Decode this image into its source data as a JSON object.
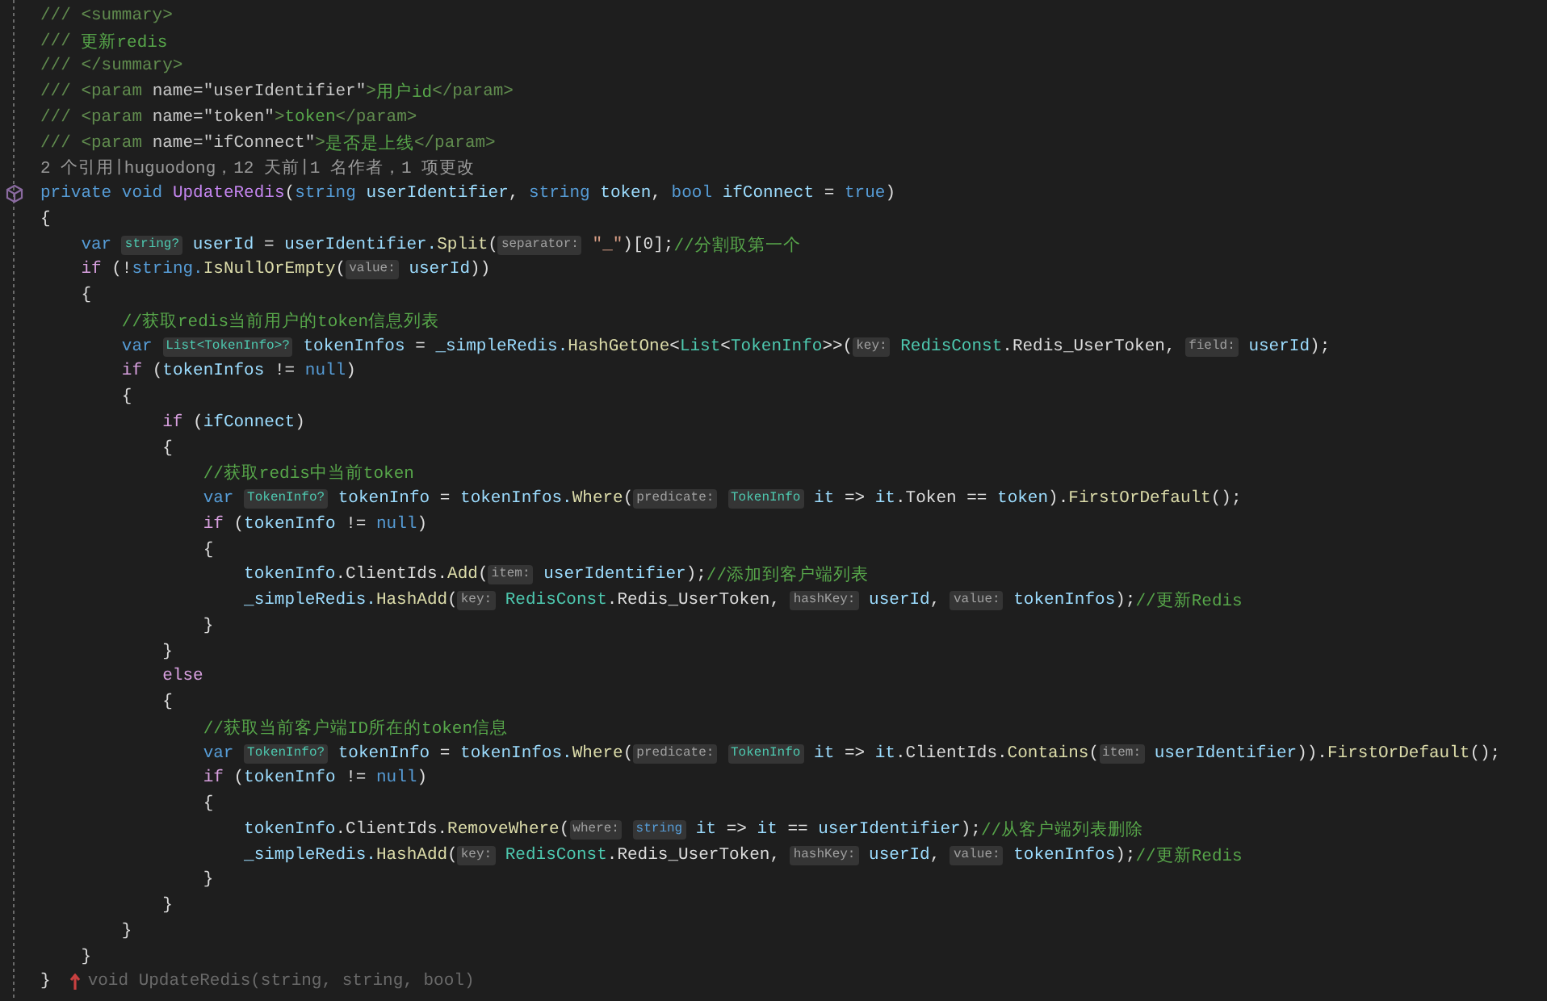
{
  "editor": {
    "lines": [
      {
        "kind": "code",
        "tokens": [
          {
            "kind": "doc",
            "text": "/// <summary>"
          }
        ]
      },
      {
        "kind": "code",
        "tokens": [
          {
            "kind": "doc",
            "text": "/// "
          },
          {
            "kind": "comment",
            "text": "更新redis"
          }
        ]
      },
      {
        "kind": "code",
        "tokens": [
          {
            "kind": "doc",
            "text": "/// </summary>"
          }
        ]
      },
      {
        "kind": "code",
        "tokens": [
          {
            "kind": "doc",
            "text": "/// <param "
          },
          {
            "kind": "doc-attr",
            "text": "name=\"userIdentifier\""
          },
          {
            "kind": "doc",
            "text": ">"
          },
          {
            "kind": "comment",
            "text": "用户id"
          },
          {
            "kind": "doc",
            "text": "</param>"
          }
        ]
      },
      {
        "kind": "code",
        "tokens": [
          {
            "kind": "doc",
            "text": "/// <param "
          },
          {
            "kind": "doc-attr",
            "text": "name=\"token\""
          },
          {
            "kind": "doc",
            "text": ">"
          },
          {
            "kind": "comment",
            "text": "token"
          },
          {
            "kind": "doc",
            "text": "</param>"
          }
        ]
      },
      {
        "kind": "code",
        "tokens": [
          {
            "kind": "doc",
            "text": "/// <param "
          },
          {
            "kind": "doc-attr",
            "text": "name=\"ifConnect\""
          },
          {
            "kind": "doc",
            "text": ">"
          },
          {
            "kind": "comment",
            "text": "是否是上线"
          },
          {
            "kind": "doc",
            "text": "</param>"
          }
        ]
      },
      {
        "kind": "lens",
        "tokens": [
          {
            "kind": "lens",
            "text": "2 个引用"
          },
          {
            "kind": "separator",
            "text": "|"
          },
          {
            "kind": "lens",
            "text": "huguodong，12 天前"
          },
          {
            "kind": "separator",
            "text": "|"
          },
          {
            "kind": "lens",
            "text": "1 名作者，1 项更改"
          }
        ]
      },
      {
        "kind": "declaration",
        "tokens": [
          {
            "kind": "keyword",
            "text": "private void"
          },
          {
            "kind": "member",
            "text": "UpdateRedis"
          },
          {
            "kind": "plain",
            "text": "("
          },
          {
            "kind": "keyword",
            "text": "string"
          },
          {
            "kind": "variable",
            "text": "userIdentifier"
          },
          {
            "kind": "plain",
            "text": ","
          },
          {
            "kind": "keyword",
            "text": "string"
          },
          {
            "kind": "variable",
            "text": "token"
          },
          {
            "kind": "plain",
            "text": ","
          },
          {
            "kind": "keyword",
            "text": "bool"
          },
          {
            "kind": "variable",
            "text": "ifConnect"
          },
          {
            "kind": "plain",
            "text": "="
          },
          {
            "kind": "keyword",
            "text": "true"
          },
          {
            "kind": "plain",
            "text": ")"
          }
        ]
      },
      {
        "kind": "code",
        "tokens": [
          {
            "kind": "plain",
            "text": "{"
          }
        ]
      },
      {
        "kind": "code",
        "tokens": [
          {
            "kind": "keyword",
            "text": "    var"
          },
          {
            "kind": "hint-type",
            "text": "string?"
          },
          {
            "kind": "variable",
            "text": "userId"
          },
          {
            "kind": "plain",
            "text": "="
          },
          {
            "kind": "variable",
            "text": "userIdentifier."
          },
          {
            "kind": "method",
            "text": "Split"
          },
          {
            "kind": "plain",
            "text": "("
          },
          {
            "kind": "hint",
            "text": "separator:"
          },
          {
            "kind": "string",
            "text": "\"_\""
          },
          {
            "kind": "plain",
            "text": ")[0];"
          },
          {
            "kind": "comment",
            "text": "//分割取第一个"
          }
        ]
      },
      {
        "kind": "code",
        "tokens": [
          {
            "kind": "control",
            "text": "    if"
          },
          {
            "kind": "plain",
            "text": "(!"
          },
          {
            "kind": "keyword",
            "text": "string."
          },
          {
            "kind": "method",
            "text": "IsNullOrEmpty"
          },
          {
            "kind": "plain",
            "text": "("
          },
          {
            "kind": "hint",
            "text": "value:"
          },
          {
            "kind": "variable",
            "text": "userId"
          },
          {
            "kind": "plain",
            "text": "))"
          }
        ]
      },
      {
        "kind": "code",
        "tokens": [
          {
            "kind": "plain",
            "text": "    {"
          }
        ]
      },
      {
        "kind": "code",
        "tokens": [
          {
            "kind": "comment",
            "text": "        //获取redis当前用户的token信息列表"
          }
        ]
      },
      {
        "kind": "code",
        "tokens": [
          {
            "kind": "keyword",
            "text": "        var"
          },
          {
            "kind": "hint-type",
            "text": "List<TokenInfo>?"
          },
          {
            "kind": "variable",
            "text": "tokenInfos"
          },
          {
            "kind": "plain",
            "text": "="
          },
          {
            "kind": "variable",
            "text": "_simpleRedis."
          },
          {
            "kind": "method",
            "text": "HashGetOne"
          },
          {
            "kind": "plain",
            "text": "<"
          },
          {
            "kind": "type",
            "text": "List"
          },
          {
            "kind": "plain",
            "text": "<"
          },
          {
            "kind": "type",
            "text": "TokenInfo"
          },
          {
            "kind": "plain",
            "text": ">>("
          },
          {
            "kind": "hint",
            "text": "key:"
          },
          {
            "kind": "type",
            "text": "RedisConst"
          },
          {
            "kind": "plain",
            "text": ".Redis_UserToken,"
          },
          {
            "kind": "hint",
            "text": "field:"
          },
          {
            "kind": "variable",
            "text": "userId"
          },
          {
            "kind": "plain",
            "text": ");"
          }
        ]
      },
      {
        "kind": "code",
        "tokens": [
          {
            "kind": "control",
            "text": "        if"
          },
          {
            "kind": "plain",
            "text": "("
          },
          {
            "kind": "variable",
            "text": "tokenInfos"
          },
          {
            "kind": "plain",
            "text": "!="
          },
          {
            "kind": "keyword",
            "text": "null"
          },
          {
            "kind": "plain",
            "text": ")"
          }
        ]
      },
      {
        "kind": "code",
        "tokens": [
          {
            "kind": "plain",
            "text": "        {"
          }
        ]
      },
      {
        "kind": "code",
        "tokens": [
          {
            "kind": "control",
            "text": "            if"
          },
          {
            "kind": "plain",
            "text": "("
          },
          {
            "kind": "variable",
            "text": "ifConnect"
          },
          {
            "kind": "plain",
            "text": ")"
          }
        ]
      },
      {
        "kind": "code",
        "tokens": [
          {
            "kind": "plain",
            "text": "            {"
          }
        ]
      },
      {
        "kind": "code",
        "tokens": [
          {
            "kind": "comment",
            "text": "                //获取redis中当前token"
          }
        ]
      },
      {
        "kind": "code",
        "tokens": [
          {
            "kind": "keyword",
            "text": "                var"
          },
          {
            "kind": "hint-type",
            "text": "TokenInfo?"
          },
          {
            "kind": "variable",
            "text": "tokenInfo"
          },
          {
            "kind": "plain",
            "text": "="
          },
          {
            "kind": "variable",
            "text": "tokenInfos."
          },
          {
            "kind": "method",
            "text": "Where"
          },
          {
            "kind": "plain",
            "text": "("
          },
          {
            "kind": "hint",
            "text": "predicate:"
          },
          {
            "kind": "hint-type",
            "text": "TokenInfo"
          },
          {
            "kind": "variable",
            "text": "it"
          },
          {
            "kind": "plain",
            "text": "=>"
          },
          {
            "kind": "variable",
            "text": "it"
          },
          {
            "kind": "plain",
            "text": ".Token =="
          },
          {
            "kind": "variable",
            "text": "token"
          },
          {
            "kind": "plain",
            "text": ")."
          },
          {
            "kind": "method",
            "text": "FirstOrDefault"
          },
          {
            "kind": "plain",
            "text": "();"
          }
        ]
      },
      {
        "kind": "code",
        "tokens": [
          {
            "kind": "control",
            "text": "                if"
          },
          {
            "kind": "plain",
            "text": "("
          },
          {
            "kind": "variable",
            "text": "tokenInfo"
          },
          {
            "kind": "plain",
            "text": "!="
          },
          {
            "kind": "keyword",
            "text": "null"
          },
          {
            "kind": "plain",
            "text": ")"
          }
        ]
      },
      {
        "kind": "code",
        "tokens": [
          {
            "kind": "plain",
            "text": "                {"
          }
        ]
      },
      {
        "kind": "code",
        "tokens": [
          {
            "kind": "variable",
            "text": "                    tokenInfo"
          },
          {
            "kind": "plain",
            "text": ".ClientIds."
          },
          {
            "kind": "method",
            "text": "Add"
          },
          {
            "kind": "plain",
            "text": "("
          },
          {
            "kind": "hint",
            "text": "item:"
          },
          {
            "kind": "variable",
            "text": "userIdentifier"
          },
          {
            "kind": "plain",
            "text": ");"
          },
          {
            "kind": "comment",
            "text": "//添加到客户端列表"
          }
        ]
      },
      {
        "kind": "code",
        "tokens": [
          {
            "kind": "variable",
            "text": "                    _simpleRedis."
          },
          {
            "kind": "method",
            "text": "HashAdd"
          },
          {
            "kind": "plain",
            "text": "("
          },
          {
            "kind": "hint",
            "text": "key:"
          },
          {
            "kind": "type",
            "text": "RedisConst"
          },
          {
            "kind": "plain",
            "text": ".Redis_UserToken,"
          },
          {
            "kind": "hint",
            "text": "hashKey:"
          },
          {
            "kind": "variable",
            "text": "userId"
          },
          {
            "kind": "plain",
            "text": ","
          },
          {
            "kind": "hint",
            "text": "value:"
          },
          {
            "kind": "variable",
            "text": "tokenInfos"
          },
          {
            "kind": "plain",
            "text": ");"
          },
          {
            "kind": "comment",
            "text": "//更新Redis"
          }
        ]
      },
      {
        "kind": "code",
        "tokens": [
          {
            "kind": "plain",
            "text": "                }"
          }
        ]
      },
      {
        "kind": "code",
        "tokens": [
          {
            "kind": "plain",
            "text": "            }"
          }
        ]
      },
      {
        "kind": "code",
        "tokens": [
          {
            "kind": "control",
            "text": "            else"
          }
        ]
      },
      {
        "kind": "code",
        "tokens": [
          {
            "kind": "plain",
            "text": "            {"
          }
        ]
      },
      {
        "kind": "code",
        "tokens": [
          {
            "kind": "comment",
            "text": "                //获取当前客户端ID所在的token信息"
          }
        ]
      },
      {
        "kind": "code",
        "tokens": [
          {
            "kind": "keyword",
            "text": "                var"
          },
          {
            "kind": "hint-type",
            "text": "TokenInfo?"
          },
          {
            "kind": "variable",
            "text": "tokenInfo"
          },
          {
            "kind": "plain",
            "text": "="
          },
          {
            "kind": "variable",
            "text": "tokenInfos."
          },
          {
            "kind": "method",
            "text": "Where"
          },
          {
            "kind": "plain",
            "text": "("
          },
          {
            "kind": "hint",
            "text": "predicate:"
          },
          {
            "kind": "hint-type",
            "text": "TokenInfo"
          },
          {
            "kind": "variable",
            "text": "it"
          },
          {
            "kind": "plain",
            "text": "=>"
          },
          {
            "kind": "variable",
            "text": "it"
          },
          {
            "kind": "plain",
            "text": ".ClientIds."
          },
          {
            "kind": "method",
            "text": "Contains"
          },
          {
            "kind": "plain",
            "text": "("
          },
          {
            "kind": "hint",
            "text": "item:"
          },
          {
            "kind": "variable",
            "text": "userIdentifier"
          },
          {
            "kind": "plain",
            "text": "))."
          },
          {
            "kind": "method",
            "text": "FirstOrDefault"
          },
          {
            "kind": "plain",
            "text": "();"
          }
        ]
      },
      {
        "kind": "code",
        "tokens": [
          {
            "kind": "control",
            "text": "                if"
          },
          {
            "kind": "plain",
            "text": "("
          },
          {
            "kind": "variable",
            "text": "tokenInfo"
          },
          {
            "kind": "plain",
            "text": "!="
          },
          {
            "kind": "keyword",
            "text": "null"
          },
          {
            "kind": "plain",
            "text": ")"
          }
        ]
      },
      {
        "kind": "code",
        "tokens": [
          {
            "kind": "plain",
            "text": "                {"
          }
        ]
      },
      {
        "kind": "code",
        "tokens": [
          {
            "kind": "variable",
            "text": "                    tokenInfo"
          },
          {
            "kind": "plain",
            "text": ".ClientIds."
          },
          {
            "kind": "method",
            "text": "RemoveWhere"
          },
          {
            "kind": "plain",
            "text": "("
          },
          {
            "kind": "hint",
            "text": "where:"
          },
          {
            "kind": "hint-keyword",
            "text": "string"
          },
          {
            "kind": "variable",
            "text": "it"
          },
          {
            "kind": "plain",
            "text": "=>"
          },
          {
            "kind": "variable",
            "text": "it"
          },
          {
            "kind": "plain",
            "text": "=="
          },
          {
            "kind": "variable",
            "text": "userIdentifier"
          },
          {
            "kind": "plain",
            "text": ");"
          },
          {
            "kind": "comment",
            "text": "//从客户端列表删除"
          }
        ]
      },
      {
        "kind": "code",
        "tokens": [
          {
            "kind": "variable",
            "text": "                    _simpleRedis."
          },
          {
            "kind": "method",
            "text": "HashAdd"
          },
          {
            "kind": "plain",
            "text": "("
          },
          {
            "kind": "hint",
            "text": "key:"
          },
          {
            "kind": "type",
            "text": "RedisConst"
          },
          {
            "kind": "plain",
            "text": ".Redis_UserToken,"
          },
          {
            "kind": "hint",
            "text": "hashKey:"
          },
          {
            "kind": "variable",
            "text": "userId"
          },
          {
            "kind": "plain",
            "text": ","
          },
          {
            "kind": "hint",
            "text": "value:"
          },
          {
            "kind": "variable",
            "text": "tokenInfos"
          },
          {
            "kind": "plain",
            "text": ");"
          },
          {
            "kind": "comment",
            "text": "//更新Redis"
          }
        ]
      },
      {
        "kind": "code",
        "tokens": [
          {
            "kind": "plain",
            "text": "                }"
          }
        ]
      },
      {
        "kind": "code",
        "tokens": [
          {
            "kind": "plain",
            "text": "            }"
          }
        ]
      },
      {
        "kind": "code",
        "tokens": [
          {
            "kind": "plain",
            "text": "        }"
          }
        ]
      },
      {
        "kind": "code",
        "tokens": [
          {
            "kind": "plain",
            "text": "    }"
          }
        ]
      },
      {
        "kind": "code",
        "tokens": [
          {
            "kind": "plain",
            "text": "}"
          },
          {
            "kind": "scope-hint",
            "text": "void UpdateRedis(string, string, bool)"
          }
        ]
      }
    ]
  }
}
